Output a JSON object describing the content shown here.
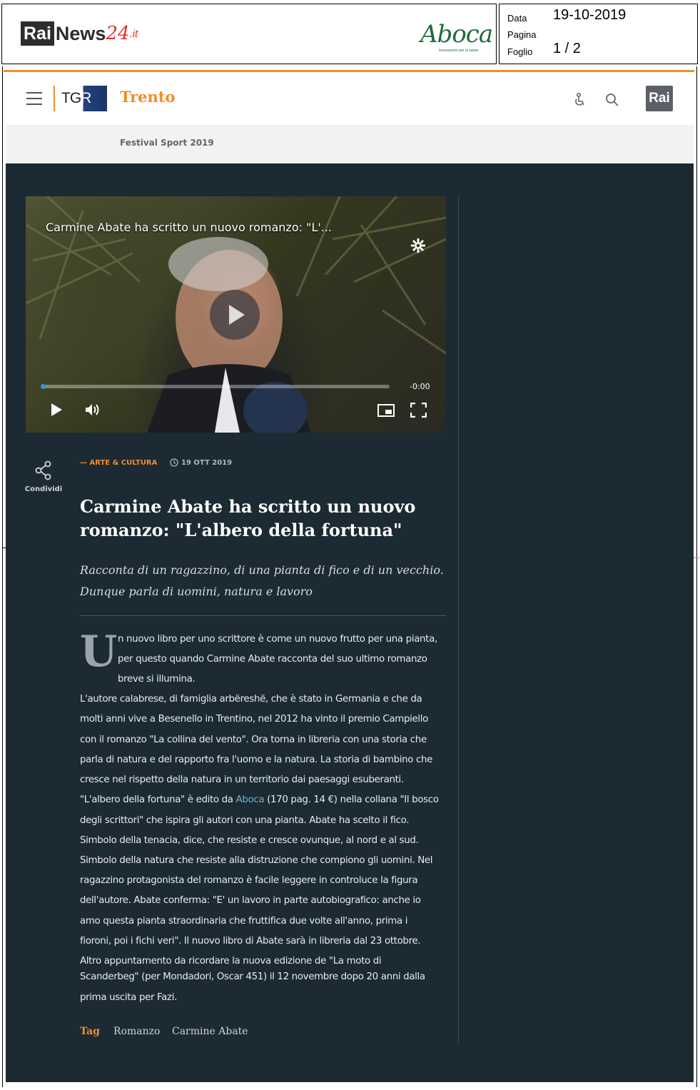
{
  "clipping": {
    "source_logo": {
      "rai": "Rai",
      "news": "News",
      "num": "24",
      "tld": ".it"
    },
    "sponsor_logo": {
      "name": "Aboca",
      "tagline": "Innovazione per la salute"
    },
    "meta": {
      "data_label": "Data",
      "data_value": "19-10-2019",
      "pagina_label": "Pagina",
      "pagina_value": "",
      "foglio_label": "Foglio",
      "foglio_value": "1 / 2"
    }
  },
  "header": {
    "logo_text": "TGR",
    "region": "Trento",
    "rai_badge": "Rai",
    "icons": [
      "menu-icon",
      "accessibility-icon",
      "search-icon"
    ]
  },
  "subnav": {
    "items": [
      "Festival Sport 2019"
    ]
  },
  "video": {
    "title": "Carmine Abate ha scritto un nuovo romanzo: \"L'...",
    "time_remaining": "-0:00",
    "progress_fraction": 0.0,
    "icons": [
      "settings-icon",
      "play-icon",
      "volume-icon",
      "picture-in-picture-icon",
      "fullscreen-icon"
    ]
  },
  "share": {
    "label": "Condividi"
  },
  "article": {
    "category": "— ARTE & CULTURA",
    "date": "19 OTT 2019",
    "headline": "Carmine Abate ha scritto un nuovo romanzo: \"L'albero della fortuna\"",
    "lead": "Racconta di un ragazzino, di una pianta di fico e di un vecchio. Dunque parla di uomini, natura e lavoro",
    "dropcap": "U",
    "lines": [
      "n nuovo libro per uno scrittore è come un nuovo frutto per una pianta,",
      "per questo quando Carmine Abate racconta del suo ultimo romanzo",
      "breve si illumina.",
      "L'autore calabrese, di famiglia arbëreshë, che è stato in Germania e che da",
      "molti anni vive a Besenello in Trentino, nel 2012 ha vinto il premio Campiello",
      "con il romanzo \"La collina del vento\". Ora torna in libreria con una storia che",
      "parla di natura e del rapporto fra l'uomo e la natura. La storia di bambino che",
      "cresce nel rispetto della natura in un territorio dai paesaggi esuberanti.",
      "\"L'albero della fortuna\" è edito da ",
      "Aboca",
      " (170 pag. 14 €) nella collana \"Il bosco",
      "degli scrittori\" che ispira gli autori con una pianta.  Abate ha scelto il fico.",
      "Simbolo della tenacia, dice, che resiste e cresce ovunque, al nord e al sud.",
      "Simbolo della natura che resiste alla distruzione che compiono gli uomini. Nel",
      "ragazzino protagonista del romanzo è facile leggere in controluce la figura",
      "dell'autore. Abate conferma: \"E' un lavoro in parte autobiografico: anche io",
      "amo questa pianta straordinaria che fruttifica due volte all'anno, prima i",
      "fioroni, poi i fichi veri\". Il nuovo libro di Abate sarà in libreria dal 23 ottobre.",
      "Altro appuntamento da ricordare la nuova edizione de \"La moto di",
      "Scanderbeg\" (per Mondadori, Oscar 451) il 12 novembre dopo 20 anni dalla",
      "prima uscita per Fazi."
    ],
    "tags_label": "Tag",
    "tags": [
      "Romanzo",
      "Carmine Abate"
    ]
  },
  "colors": {
    "accent": "#f08d2b",
    "article_bg": "#1c2a33",
    "link": "#6fb4d3"
  }
}
